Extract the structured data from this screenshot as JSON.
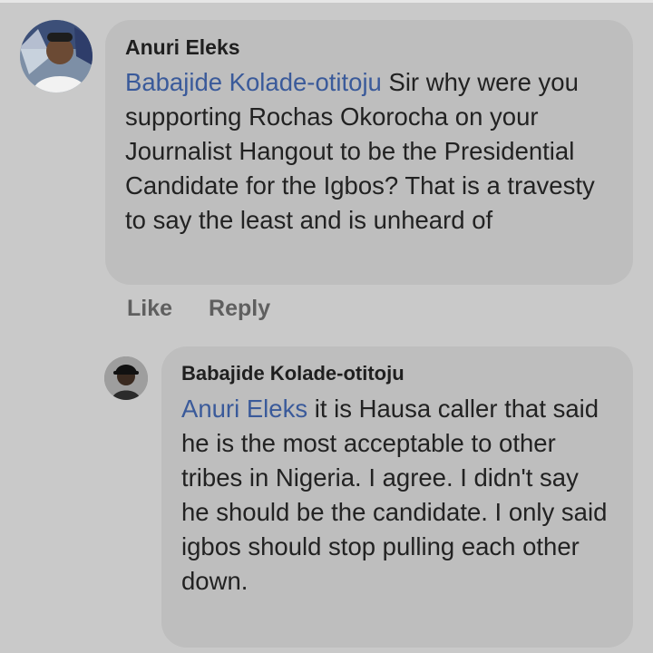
{
  "colors": {
    "background": "#c9c9c9",
    "bubble": "#bebebe",
    "mention": "#3a5a9a",
    "text": "#222222",
    "action": "#5f5f5f"
  },
  "comment": {
    "author": "Anuri Eleks",
    "avatar_icon": "user-avatar-icon",
    "mention": "Babajide Kolade-otitoju",
    "text": " Sir why were you supporting Rochas Okorocha on your Journalist Hangout to be the Presidential Candidate for the Igbos? That is a travesty to say the least and is unheard of",
    "actions": {
      "like": "Like",
      "reply": "Reply"
    }
  },
  "reply": {
    "author": "Babajide Kolade-otitoju",
    "avatar_icon": "user-avatar-icon",
    "mention": "Anuri Eleks",
    "text": " it is Hausa caller that said he is the most acceptable to other tribes in Nigeria. I agree. I didn't say he should be the candidate. I only said igbos should stop pulling each other down."
  }
}
